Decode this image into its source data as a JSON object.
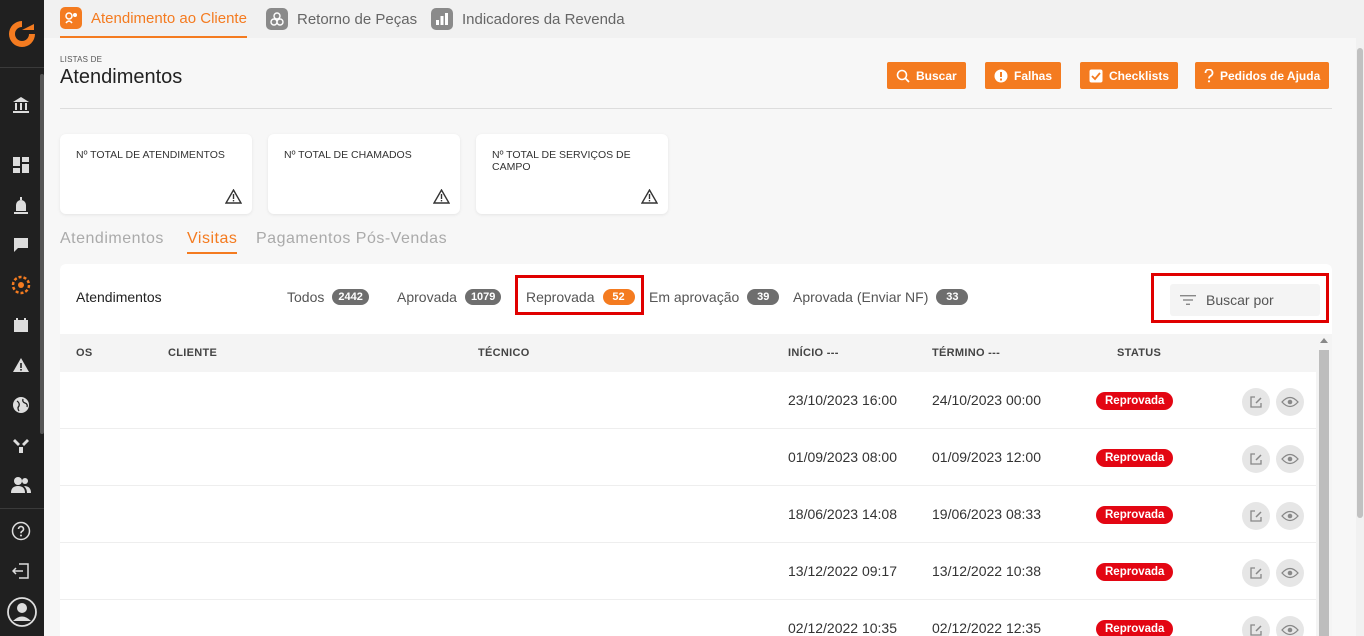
{
  "colors": {
    "accent": "#f47b20",
    "sidebar": "#202020",
    "status_reprovada": "#e30613",
    "highlight": "#e00000"
  },
  "sidebar": {
    "icons": [
      "logo-icon",
      "bank-icon",
      "dashboard-icon",
      "alarm-icon",
      "chat-icon",
      "service-icon",
      "calendar-icon",
      "alert-icon",
      "globe-icon",
      "tools-icon",
      "users-icon",
      "help-icon",
      "logout-icon",
      "avatar-icon"
    ]
  },
  "topnav": {
    "tabs": [
      {
        "label": "Atendimento ao Cliente",
        "icon": "customer-service-icon",
        "active": true
      },
      {
        "label": "Retorno de Peças",
        "icon": "parts-icon",
        "active": false
      },
      {
        "label": "Indicadores da Revenda",
        "icon": "bar-chart-icon",
        "active": false
      }
    ]
  },
  "header": {
    "eyebrow": "LISTAS DE",
    "title": "Atendimentos",
    "buttons": [
      {
        "label": "Buscar",
        "icon": "search-icon"
      },
      {
        "label": "Falhas",
        "icon": "alert-circle-icon"
      },
      {
        "label": "Checklists",
        "icon": "checkbox-icon"
      },
      {
        "label": "Pedidos de Ajuda",
        "icon": "question-icon"
      }
    ]
  },
  "cards": [
    {
      "label": "Nº TOTAL DE ATENDIMENTOS"
    },
    {
      "label": "Nº TOTAL DE CHAMADOS"
    },
    {
      "label": "Nº TOTAL DE SERVIÇOS DE CAMPO"
    }
  ],
  "subtabs": [
    {
      "label": "Atendimentos",
      "active": false
    },
    {
      "label": "Visitas",
      "active": true
    },
    {
      "label": "Pagamentos Pós-Vendas",
      "active": false
    }
  ],
  "panel": {
    "title": "Atendimentos",
    "filters": [
      {
        "label": "Todos",
        "count": "2442"
      },
      {
        "label": "Aprovada",
        "count": "1079"
      },
      {
        "label": "Reprovada",
        "count": "52",
        "selected": true
      },
      {
        "label": "Em aprovação",
        "count": "39"
      },
      {
        "label": "Aprovada (Enviar NF)",
        "count": "33"
      }
    ],
    "search_placeholder": "Buscar por"
  },
  "table": {
    "headers": {
      "os": "OS",
      "cliente": "CLIENTE",
      "tecnico": "TÉCNICO",
      "inicio": "INÍCIO ---",
      "termino": "TÉRMINO ---",
      "status": "STATUS"
    },
    "rows": [
      {
        "inicio": "23/10/2023 16:00",
        "termino": "24/10/2023 00:00",
        "status": "Reprovada"
      },
      {
        "inicio": "01/09/2023 08:00",
        "termino": "01/09/2023 12:00",
        "status": "Reprovada"
      },
      {
        "inicio": "18/06/2023 14:08",
        "termino": "19/06/2023 08:33",
        "status": "Reprovada"
      },
      {
        "inicio": "13/12/2022 09:17",
        "termino": "13/12/2022 10:38",
        "status": "Reprovada"
      },
      {
        "inicio": "02/12/2022 10:35",
        "termino": "02/12/2022 12:35",
        "status": "Reprovada"
      }
    ]
  }
}
